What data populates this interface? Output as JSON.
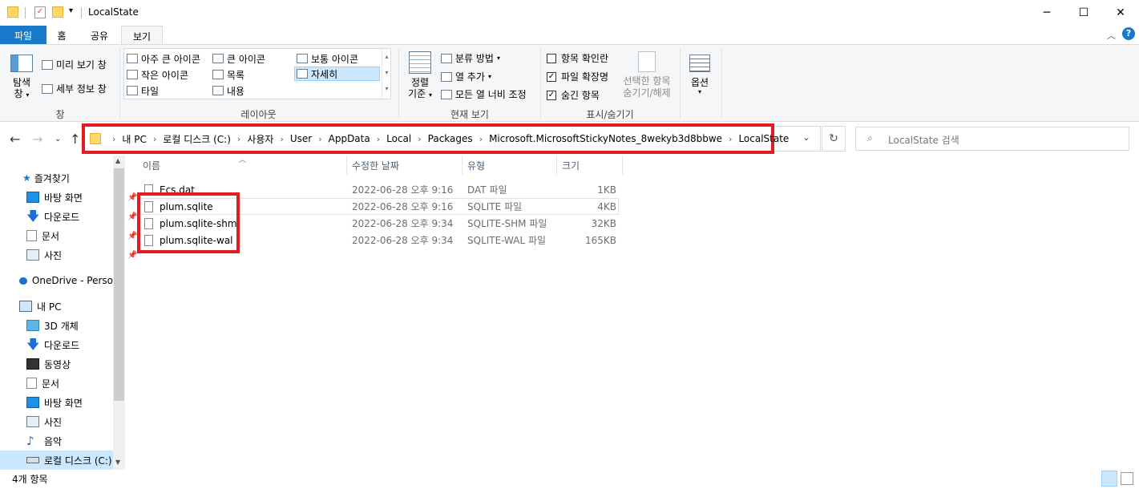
{
  "window": {
    "title": "LocalState",
    "minimize": "─",
    "maximize": "☐",
    "close": "✕"
  },
  "tabs": [
    {
      "label": "파일"
    },
    {
      "label": "홈"
    },
    {
      "label": "공유"
    },
    {
      "label": "보기"
    }
  ],
  "ribbon": {
    "pane": {
      "nav_pane_line1": "탐색",
      "nav_pane_line2": "창",
      "preview": "미리 보기 창",
      "details": "세부 정보 창",
      "group": "창"
    },
    "layout": {
      "items": [
        "아주 큰 아이콘",
        "큰 아이콘",
        "보통 아이콘",
        "작은 아이콘",
        "목록",
        "자세히",
        "타일",
        "내용"
      ],
      "selected": "자세히",
      "group": "레이아웃"
    },
    "current_view": {
      "sort_line1": "정렬",
      "sort_line2": "기준",
      "group_by": "분류 방법",
      "add_columns": "열 추가",
      "fit_columns": "모든 열 너비 조정",
      "group": "현재 보기"
    },
    "show_hide": {
      "item_checkboxes": "항목 확인란",
      "item_checkboxes_checked": false,
      "file_extensions": "파일 확장명",
      "file_extensions_checked": true,
      "hidden_items": "숨긴 항목",
      "hidden_items_checked": true,
      "hide_selected_line1": "선택한 항목",
      "hide_selected_line2": "숨기기/해제",
      "group": "표시/숨기기"
    },
    "options": {
      "label": "옵션"
    }
  },
  "address": {
    "crumbs": [
      "내 PC",
      "로컬 디스크 (C:)",
      "사용자",
      "User",
      "AppData",
      "Local",
      "Packages",
      "Microsoft.MicrosoftStickyNotes_8wekyb3d8bbwe",
      "LocalState"
    ],
    "search_placeholder": "LocalState 검색"
  },
  "nav_pane": {
    "quick_access": "즐겨찾기",
    "quick_items": [
      "바탕 화면",
      "다운로드",
      "문서",
      "사진"
    ],
    "onedrive": "OneDrive - Perso",
    "this_pc": "내 PC",
    "pc_items": [
      "3D 개체",
      "다운로드",
      "동영상",
      "문서",
      "바탕 화면",
      "사진",
      "음악",
      "로컬 디스크 (C:)"
    ]
  },
  "file_list": {
    "columns": [
      "이름",
      "수정한 날짜",
      "유형",
      "크기"
    ],
    "rows": [
      {
        "name": "Ecs.dat",
        "date": "2022-06-28 오후 9:16",
        "type": "DAT 파일",
        "size": "1KB"
      },
      {
        "name": "plum.sqlite",
        "date": "2022-06-28 오후 9:16",
        "type": "SQLITE 파일",
        "size": "4KB"
      },
      {
        "name": "plum.sqlite-shm",
        "date": "2022-06-28 오후 9:34",
        "type": "SQLITE-SHM 파일",
        "size": "32KB"
      },
      {
        "name": "plum.sqlite-wal",
        "date": "2022-06-28 오후 9:34",
        "type": "SQLITE-WAL 파일",
        "size": "165KB"
      }
    ]
  },
  "status": {
    "item_count": "4개 항목"
  },
  "colors": {
    "accent": "#1979ca",
    "highlight": "#e31b23",
    "selection": "#cce8ff"
  }
}
